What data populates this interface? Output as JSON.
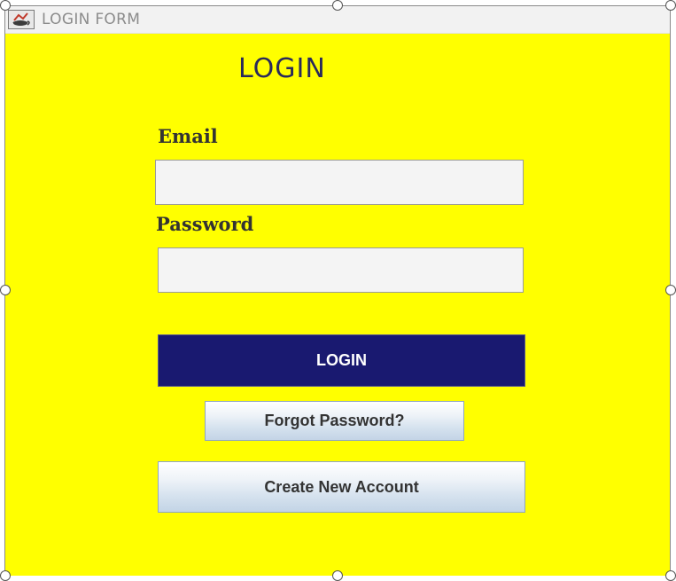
{
  "window": {
    "title": "LOGIN FORM",
    "icon": "java-cup-icon",
    "background_color": "#ffff00"
  },
  "form": {
    "heading": "LOGIN",
    "email_label": "Email",
    "email_value": "",
    "password_label": "Password",
    "password_value": "",
    "login_button": "LOGIN",
    "forgot_button": "Forgot Password?",
    "create_button": "Create New Account"
  },
  "colors": {
    "login_button_bg": "#191970",
    "field_bg": "#f4f4f4"
  }
}
